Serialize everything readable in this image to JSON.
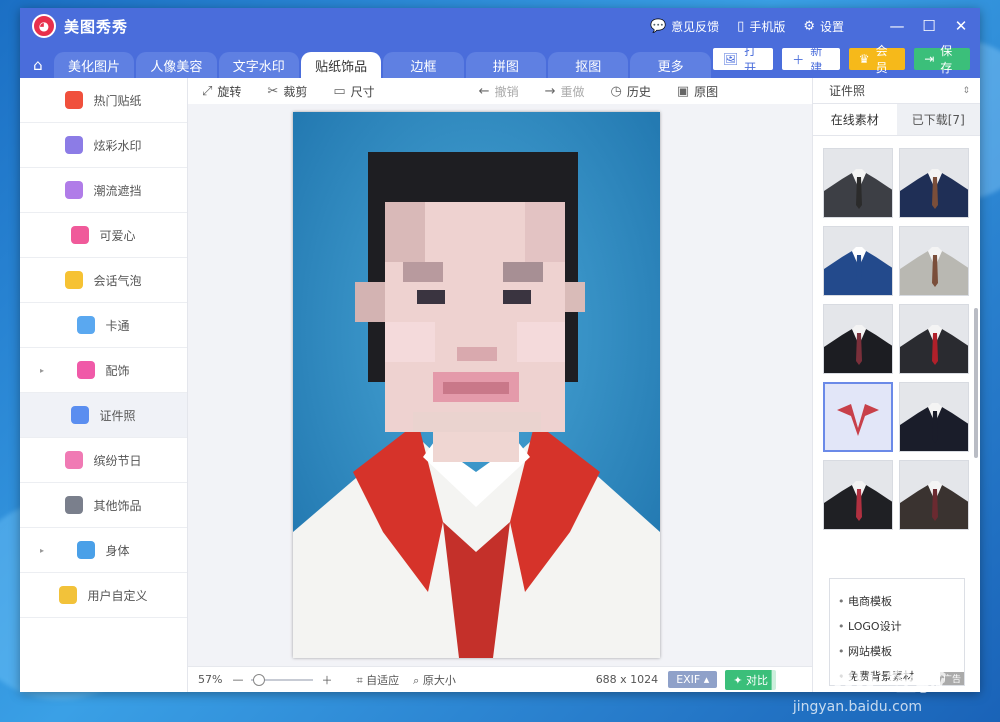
{
  "app": {
    "title": "美图秀秀",
    "logo_text": "meitu",
    "feedback": "意见反馈",
    "mobile": "手机版",
    "settings": "设置"
  },
  "tabs": [
    {
      "label": "美化图片"
    },
    {
      "label": "人像美容"
    },
    {
      "label": "文字水印"
    },
    {
      "label": "贴纸饰品"
    },
    {
      "label": "边框"
    },
    {
      "label": "拼图"
    },
    {
      "label": "抠图"
    },
    {
      "label": "更多"
    }
  ],
  "actions": {
    "open": "打开",
    "new": "新建",
    "member": "会员",
    "save": "保存"
  },
  "sidebar": {
    "items": [
      {
        "label": "热门贴纸",
        "color": "#f0503c"
      },
      {
        "label": "炫彩水印",
        "color": "#8c7ce6"
      },
      {
        "label": "潮流遮挡",
        "color": "#b07ce8"
      },
      {
        "label": "可爱心",
        "color": "#f05a9a"
      },
      {
        "label": "会话气泡",
        "color": "#f6c233"
      },
      {
        "label": "卡通",
        "color": "#5aa8f0"
      },
      {
        "label": "配饰",
        "color": "#f05aa8"
      },
      {
        "label": "证件照",
        "color": "#5a8ef0"
      },
      {
        "label": "缤纷节日",
        "color": "#f07ab4"
      },
      {
        "label": "其他饰品",
        "color": "#7a7f8c"
      },
      {
        "label": "身体",
        "color": "#4aa0e8"
      },
      {
        "label": "用户自定义",
        "color": "#f2c23a"
      }
    ]
  },
  "toolbar": {
    "rotate": "旋转",
    "crop": "裁剪",
    "size": "尺寸",
    "undo": "撤销",
    "redo": "重做",
    "history": "历史",
    "original": "原图"
  },
  "right_panel": {
    "category": "证件照",
    "tab_online": "在线素材",
    "tab_downloaded": "已下载[7]"
  },
  "ad": {
    "items": [
      "电商模板",
      "LOGO设计",
      "网站模板",
      "免费背景素材"
    ],
    "tag": "广告"
  },
  "status": {
    "zoom": "57%",
    "zoom_level": 0.12,
    "fit": "自适应",
    "actual": "原大小",
    "dimensions": "688 x 1024",
    "exif": "EXIF",
    "compare": "对比"
  },
  "watermark": {
    "text": "Bai du 经验",
    "url": "jingyan.baidu.com"
  },
  "colors": {
    "titlebar": "#4a6ddb",
    "photo_bg": "#2e8cc4",
    "collar": "#d6332a"
  }
}
